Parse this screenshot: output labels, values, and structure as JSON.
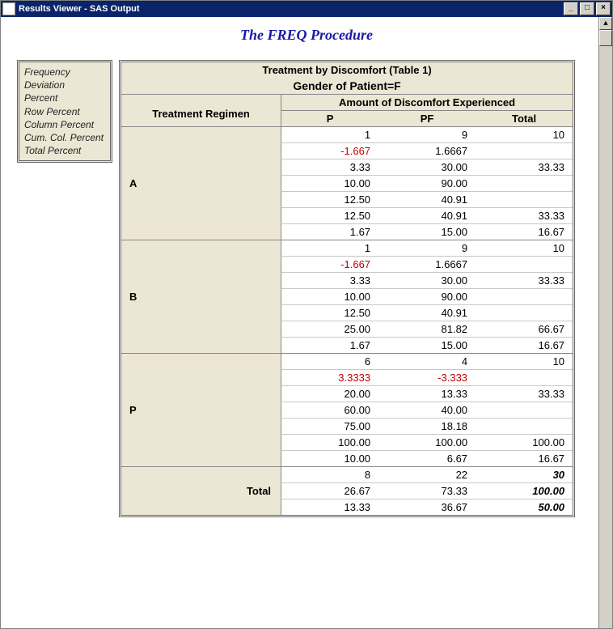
{
  "window": {
    "title": "Results Viewer - SAS Output"
  },
  "proc_title": "The FREQ Procedure",
  "legend": {
    "items": [
      "Frequency",
      "Deviation",
      "Percent",
      "Row Percent",
      "Column Percent",
      "Cum. Col. Percent",
      "Total Percent"
    ]
  },
  "table": {
    "caption": "Treatment by Discomfort (Table 1)",
    "subcaption": "Gender of Patient=F",
    "row_var_label": "Treatment Regimen",
    "col_var_label": "Amount of Discomfort Experienced",
    "col_headers": [
      "P",
      "PF",
      "Total"
    ],
    "rows": [
      {
        "label": "A",
        "cells": [
          {
            "p": "1",
            "pf": "9",
            "t": "10"
          },
          {
            "p": "-1.667",
            "pf": "1.6667",
            "t": "",
            "pneg": true
          },
          {
            "p": "3.33",
            "pf": "30.00",
            "t": "33.33"
          },
          {
            "p": "10.00",
            "pf": "90.00",
            "t": ""
          },
          {
            "p": "12.50",
            "pf": "40.91",
            "t": ""
          },
          {
            "p": "12.50",
            "pf": "40.91",
            "t": "33.33"
          },
          {
            "p": "1.67",
            "pf": "15.00",
            "t": "16.67"
          }
        ]
      },
      {
        "label": "B",
        "cells": [
          {
            "p": "1",
            "pf": "9",
            "t": "10"
          },
          {
            "p": "-1.667",
            "pf": "1.6667",
            "t": "",
            "pneg": true
          },
          {
            "p": "3.33",
            "pf": "30.00",
            "t": "33.33"
          },
          {
            "p": "10.00",
            "pf": "90.00",
            "t": ""
          },
          {
            "p": "12.50",
            "pf": "40.91",
            "t": ""
          },
          {
            "p": "25.00",
            "pf": "81.82",
            "t": "66.67"
          },
          {
            "p": "1.67",
            "pf": "15.00",
            "t": "16.67"
          }
        ]
      },
      {
        "label": "P",
        "cells": [
          {
            "p": "6",
            "pf": "4",
            "t": "10"
          },
          {
            "p": "3.3333",
            "pf": "-3.333",
            "t": "",
            "pneg": true,
            "pfneg": true
          },
          {
            "p": "20.00",
            "pf": "13.33",
            "t": "33.33"
          },
          {
            "p": "60.00",
            "pf": "40.00",
            "t": ""
          },
          {
            "p": "75.00",
            "pf": "18.18",
            "t": ""
          },
          {
            "p": "100.00",
            "pf": "100.00",
            "t": "100.00"
          },
          {
            "p": "10.00",
            "pf": "6.67",
            "t": "16.67"
          }
        ]
      }
    ],
    "total_label": "Total",
    "total": [
      {
        "p": "8",
        "pf": "22",
        "t": "30"
      },
      {
        "p": "26.67",
        "pf": "73.33",
        "t": "100.00"
      },
      {
        "p": "13.33",
        "pf": "36.67",
        "t": "50.00"
      }
    ]
  }
}
